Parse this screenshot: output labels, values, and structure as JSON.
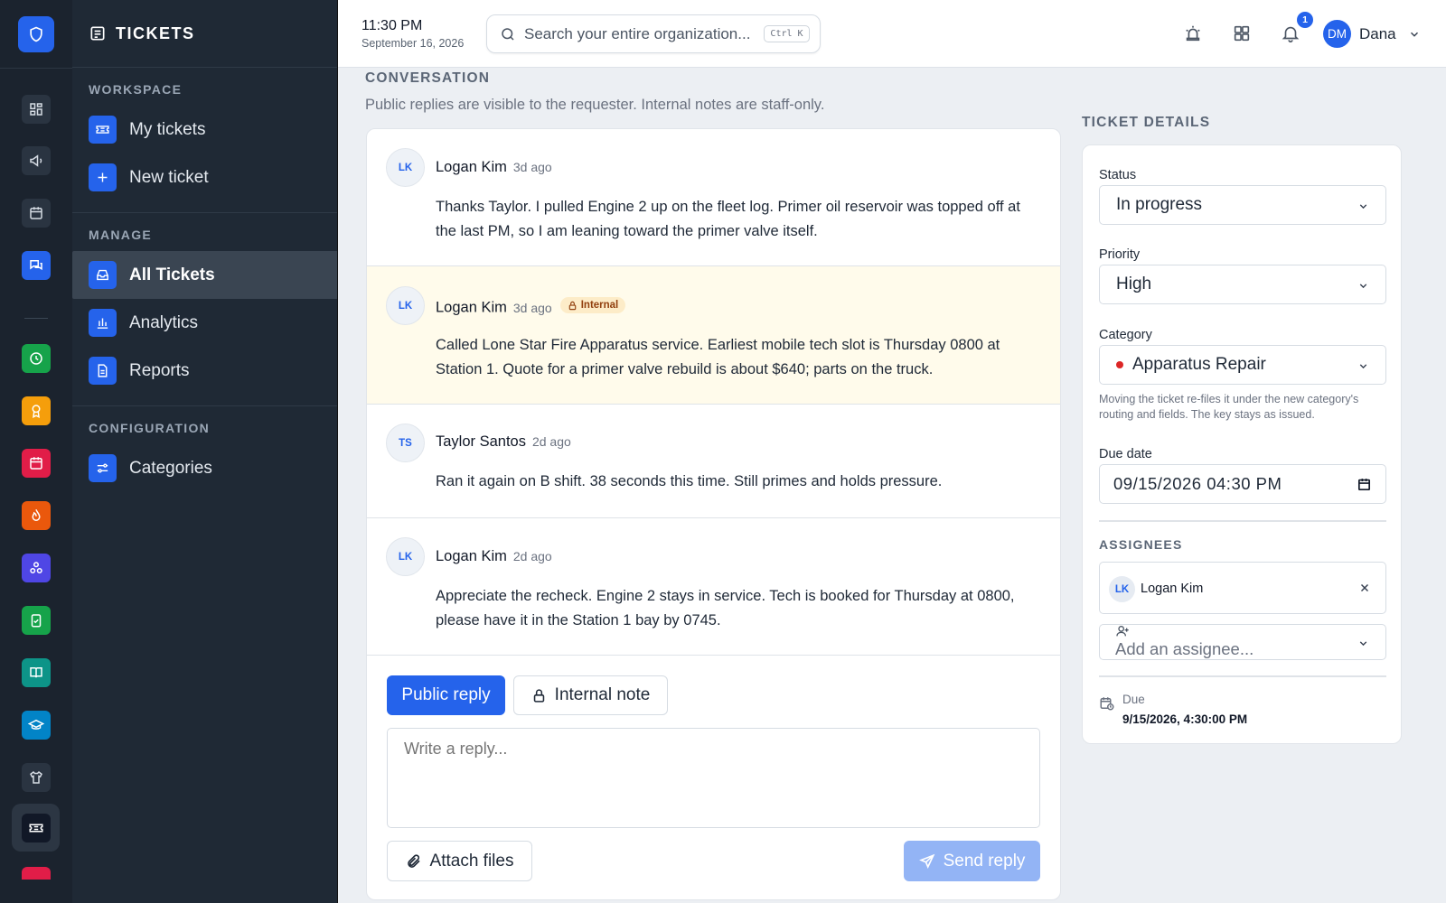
{
  "topbar": {
    "time": "11:30 PM",
    "date": "September 16, 2026",
    "search_placeholder": "Search your entire organization...",
    "search_shortcut": "Ctrl K",
    "notification_count": "1",
    "user_initials": "DM",
    "user_name": "Dana"
  },
  "sidebar": {
    "title": "TICKETS",
    "sections": [
      {
        "label": "WORKSPACE",
        "items": [
          {
            "label": "My tickets",
            "icon": "ticket-icon"
          },
          {
            "label": "New ticket",
            "icon": "plus-icon"
          }
        ]
      },
      {
        "label": "MANAGE",
        "items": [
          {
            "label": "All Tickets",
            "icon": "inbox-icon",
            "active": true
          },
          {
            "label": "Analytics",
            "icon": "bar-chart-icon"
          },
          {
            "label": "Reports",
            "icon": "document-icon"
          }
        ]
      },
      {
        "label": "CONFIGURATION",
        "items": [
          {
            "label": "Categories",
            "icon": "sliders-icon"
          }
        ]
      }
    ]
  },
  "rail": {
    "icons": [
      "shield-icon",
      "grid-icon",
      "megaphone-icon",
      "calendar-icon",
      "chat-icon",
      "clock-icon",
      "award-icon",
      "calendar-red-icon",
      "flame-icon",
      "network-icon",
      "clipboard-check-icon",
      "book-icon",
      "graduation-cap-icon",
      "shirt-icon",
      "ticket-icon"
    ],
    "colors": {
      "brand": "#2563eb",
      "green": "#16a34a",
      "amber": "#f59e0b",
      "red": "#e11d48",
      "orange": "#ea580c",
      "purple": "#4f46e5",
      "teal": "#0d9488",
      "sky": "#0284c7"
    }
  },
  "conversation": {
    "title": "CONVERSATION",
    "subtitle": "Public replies are visible to the requester. Internal notes are staff-only.",
    "messages": [
      {
        "initials": "LK",
        "author": "Logan Kim",
        "time": "3d ago",
        "internal": false,
        "body": "Thanks Taylor. I pulled Engine 2 up on the fleet log. Primer oil reservoir was topped off at the last PM, so I am leaning toward the primer valve itself."
      },
      {
        "initials": "LK",
        "author": "Logan Kim",
        "time": "3d ago",
        "internal": true,
        "internal_label": "Internal",
        "body": "Called Lone Star Fire Apparatus service. Earliest mobile tech slot is Thursday 0800 at Station 1. Quote for a primer valve rebuild is about $640; parts on the truck."
      },
      {
        "initials": "TS",
        "author": "Taylor Santos",
        "time": "2d ago",
        "internal": false,
        "body": "Ran it again on B shift. 38 seconds this time. Still primes and holds pressure."
      },
      {
        "initials": "LK",
        "author": "Logan Kim",
        "time": "2d ago",
        "internal": false,
        "body": "Appreciate the recheck. Engine 2 stays in service. Tech is booked for Thursday at 0800, please have it in the Station 1 bay by 0745."
      }
    ],
    "reply": {
      "public_label": "Public reply",
      "internal_label": "Internal note",
      "placeholder": "Write a reply...",
      "attach_label": "Attach files",
      "send_label": "Send reply"
    }
  },
  "details": {
    "title": "TICKET DETAILS",
    "status_label": "Status",
    "status_value": "In progress",
    "priority_label": "Priority",
    "priority_value": "High",
    "category_label": "Category",
    "category_value": "Apparatus Repair",
    "category_color": "#dc2626",
    "category_help": "Moving the ticket re-files it under the new category's routing and fields. The key stays as issued.",
    "due_label": "Due date",
    "due_input": "09/15/2026 04:30 PM",
    "assignees_label": "ASSIGNEES",
    "assignee_initials": "LK",
    "assignee_name": "Logan Kim",
    "add_assignee_placeholder": "Add an assignee...",
    "due_caption": "Due",
    "due_value": "9/15/2026, 4:30:00 PM"
  }
}
